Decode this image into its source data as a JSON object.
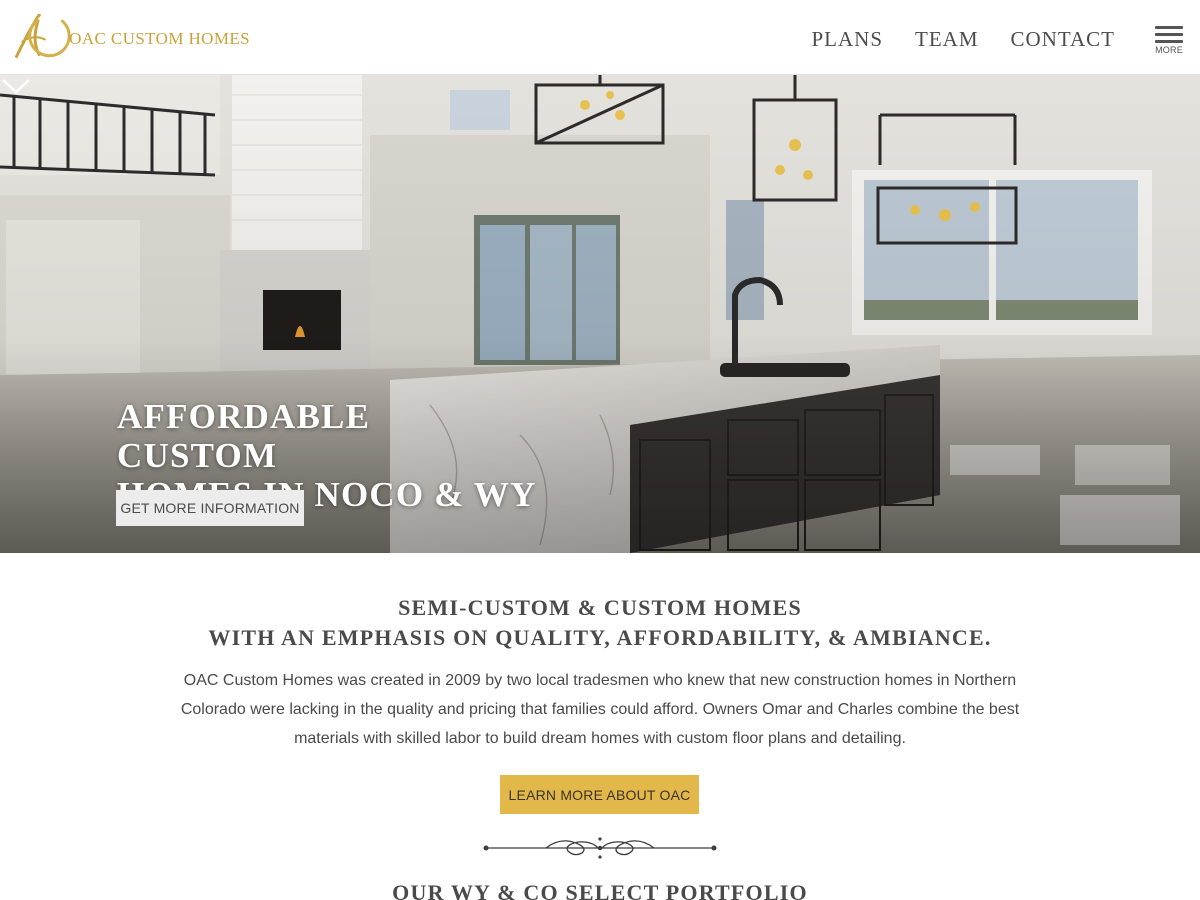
{
  "brand": {
    "name": "OAC CUSTOM HOMES",
    "logo_icon": "oac-monogram-logo",
    "accent_color": "#c9a33a"
  },
  "nav": {
    "items": [
      {
        "label": "PLANS"
      },
      {
        "label": "TEAM"
      },
      {
        "label": "CONTACT"
      }
    ],
    "menu_label": "MORE",
    "menu_icon": "hamburger-icon"
  },
  "hero": {
    "title_line1": "AFFORDABLE CUSTOM",
    "title_line2": "HOMES IN NOCO & WY",
    "button_label": "GET MORE INFORMATION",
    "scroll_icon": "chevron-down-icon"
  },
  "intro": {
    "heading_line1": "SEMI-CUSTOM & CUSTOM HOMES",
    "heading_line2": "WITH AN EMPHASIS ON QUALITY, AFFORDABILITY, & AMBIANCE.",
    "body": "OAC Custom Homes was created in 2009 by two local tradesmen who knew that new construction homes in Northern Colorado were lacking in the quality and pricing that families could afford. Owners Omar and Charles combine the best materials with skilled labor to build dream homes with custom floor plans and detailing.",
    "button_label": "LEARN MORE ABOUT OAC",
    "button_color": "#e2b84a",
    "divider_icon": "ornamental-divider-icon"
  },
  "portfolio": {
    "heading": "OUR WY & CO SELECT PORTFOLIO"
  }
}
